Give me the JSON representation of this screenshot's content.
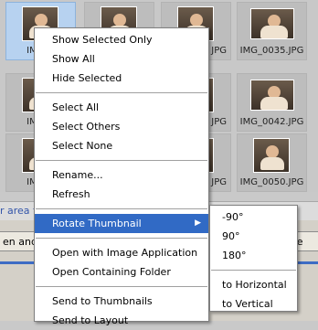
{
  "thumbnails": [
    {
      "caption": "IMG_0",
      "selected": true
    },
    {
      "caption": "",
      "selected": false
    },
    {
      "caption": "JPG",
      "selected": false
    },
    {
      "caption": "IMG_0035.JPG",
      "selected": false
    },
    {
      "caption": "IMG_0",
      "selected": false
    },
    {
      "caption": "JPG",
      "selected": false
    },
    {
      "caption": "IMG_0042.JPG",
      "selected": false
    },
    {
      "caption": "IMG_0",
      "selected": false
    },
    {
      "caption": "JPG",
      "selected": false
    },
    {
      "caption": "IMG_0050.JPG",
      "selected": false
    }
  ],
  "status": {
    "text": "r area t"
  },
  "bottom_bar": {
    "left_button": "en and S",
    "right_button": "se"
  },
  "context_menu": {
    "show_selected_only": "Show Selected Only",
    "show_all": "Show All",
    "hide_selected": "Hide Selected",
    "select_all": "Select All",
    "select_others": "Select Others",
    "select_none": "Select None",
    "rename": "Rename...",
    "refresh": "Refresh",
    "rotate_thumbnail": "Rotate Thumbnail",
    "open_with_image_application": "Open with Image Application",
    "open_containing_folder": "Open Containing Folder",
    "send_to_thumbnails": "Send to Thumbnails",
    "send_to_layout": "Send to Layout"
  },
  "rotate_submenu": {
    "rotate_minus_90": "-90°",
    "rotate_90": "90°",
    "rotate_180": "180°",
    "to_horizontal": "to Horizontal",
    "to_vertical": "to Vertical"
  },
  "icons": {
    "submenu_arrow": "triangle-right-icon"
  },
  "colors": {
    "highlight": "#316ac5",
    "selection": "#b7d2f0",
    "accent_line": "#3d6cc4"
  }
}
